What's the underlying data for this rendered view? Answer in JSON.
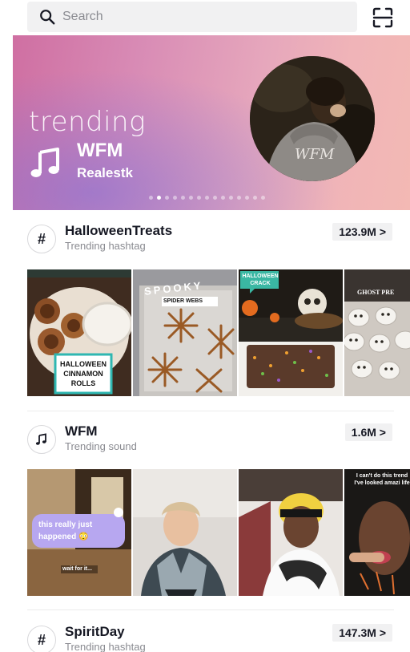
{
  "search": {
    "placeholder": "Search"
  },
  "banner": {
    "label": "trending",
    "title": "WFM",
    "artist": "Realestk",
    "avatar_text": "WFM",
    "dots_total": 15,
    "dots_active_index": 1
  },
  "sections": [
    {
      "icon": "#",
      "icon_name": "hashtag-icon",
      "name": "HalloweenTreats",
      "subtitle": "Trending hashtag",
      "count": "123.9M >",
      "thumbnails": [
        {
          "caption": "HALLOWEEN CINNAMON ROLLS"
        },
        {
          "caption": "SPOOKY",
          "sub": "SPIDER WEBS"
        },
        {
          "caption": "HALLOWEEN CRACK"
        },
        {
          "caption": "GHOST PRE"
        }
      ]
    },
    {
      "icon": "♫",
      "icon_name": "music-note-icon",
      "name": "WFM",
      "subtitle": "Trending sound",
      "count": "1.6M >",
      "thumbnails": [
        {
          "caption": "this really just happened 😳",
          "sub": "wait for it..."
        },
        {
          "caption": ""
        },
        {
          "caption": ""
        },
        {
          "caption": "I can't do this trend I've looked amazi life"
        }
      ]
    },
    {
      "icon": "#",
      "icon_name": "hashtag-icon",
      "name": "SpiritDay",
      "subtitle": "Trending hashtag",
      "count": "147.3M >"
    }
  ]
}
